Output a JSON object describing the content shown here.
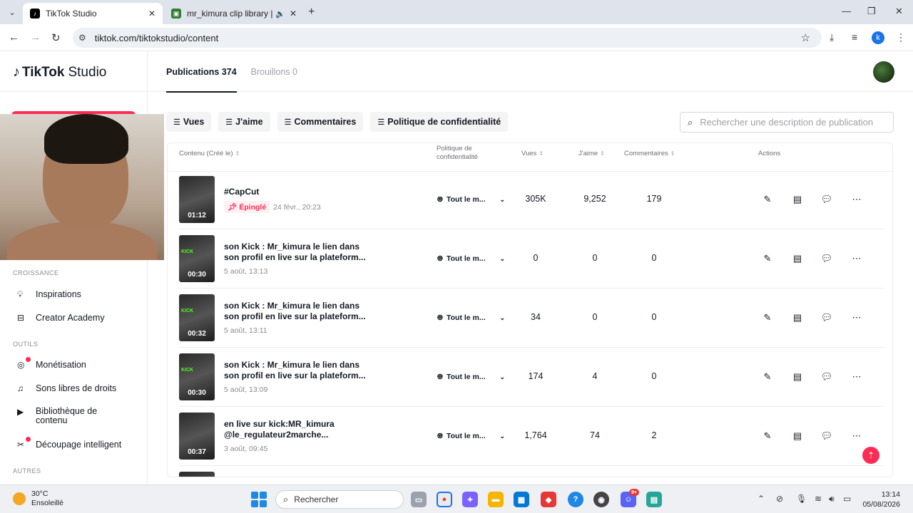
{
  "browser": {
    "tabs": [
      {
        "title": "TikTok Studio",
        "active": true
      },
      {
        "title": "mr_kimura clip library | Clip",
        "active": false
      }
    ],
    "url": "tiktok.com/tiktokstudio/content",
    "profile_initial": "k"
  },
  "app": {
    "logo_brand": "TikTok",
    "logo_product": "Studio"
  },
  "sidebar": {
    "sections": [
      {
        "label": "CROISSANCE",
        "items": [
          {
            "label": "Inspirations",
            "icon": "lightbulb-icon"
          },
          {
            "label": "Creator Academy",
            "icon": "graduation-icon"
          }
        ]
      },
      {
        "label": "OUTILS",
        "items": [
          {
            "label": "Monétisation",
            "icon": "monetization-icon"
          },
          {
            "label": "Sons libres de droits",
            "icon": "music-note-icon"
          },
          {
            "label": "Bibliothèque de contenu",
            "icon": "library-icon"
          },
          {
            "label": "Découpage intelligent",
            "icon": "smart-cut-icon"
          }
        ]
      },
      {
        "label": "AUTRES",
        "items": []
      }
    ]
  },
  "topbar": {
    "tab_publications": "Publications 374",
    "tab_drafts": "Brouillons 0"
  },
  "filters": {
    "views": "Vues",
    "likes": "J'aime",
    "comments": "Commentaires",
    "privacy": "Politique de confidentialité",
    "search_placeholder": "Rechercher une description de publication"
  },
  "table": {
    "headers": {
      "content": "Contenu (Créé le)",
      "privacy": "Politique de confidentialité",
      "views": "Vues",
      "likes": "J'aime",
      "comments": "Commentaires",
      "actions": "Actions"
    },
    "rows": [
      {
        "duration": "01:12",
        "title": "#CapCut",
        "pinned": "Épinglé",
        "date": "24 févr., 20:23",
        "privacy": "Tout le m...",
        "views": "305K",
        "likes": "9,252",
        "comments": "179"
      },
      {
        "duration": "00:30",
        "title": "son Kick : Mr_kimura le lien dans son profil en live sur la plateform...",
        "date": "5 août, 13:13",
        "privacy": "Tout le m...",
        "views": "0",
        "likes": "0",
        "comments": "0"
      },
      {
        "duration": "00:32",
        "title": "son Kick : Mr_kimura le lien dans son profil en live sur la plateform...",
        "date": "5 août, 13:11",
        "privacy": "Tout le m...",
        "views": "34",
        "likes": "0",
        "comments": "0"
      },
      {
        "duration": "00:30",
        "title": "son Kick : Mr_kimura le lien dans son profil en live sur la plateform...",
        "date": "5 août, 13:09",
        "privacy": "Tout le m...",
        "views": "174",
        "likes": "4",
        "comments": "0"
      },
      {
        "duration": "00:37",
        "title": "en live sur kick:MR_kimura @le_regulateur2marche...",
        "date": "3 août, 09:45",
        "privacy": "Tout le m...",
        "views": "1,764",
        "likes": "74",
        "comments": "2"
      }
    ]
  },
  "taskbar": {
    "temperature": "30°C",
    "weather": "Ensoleillé",
    "search_label": "Rechercher",
    "time": "13:14",
    "date": "05/08/2026",
    "badge": "9+"
  }
}
